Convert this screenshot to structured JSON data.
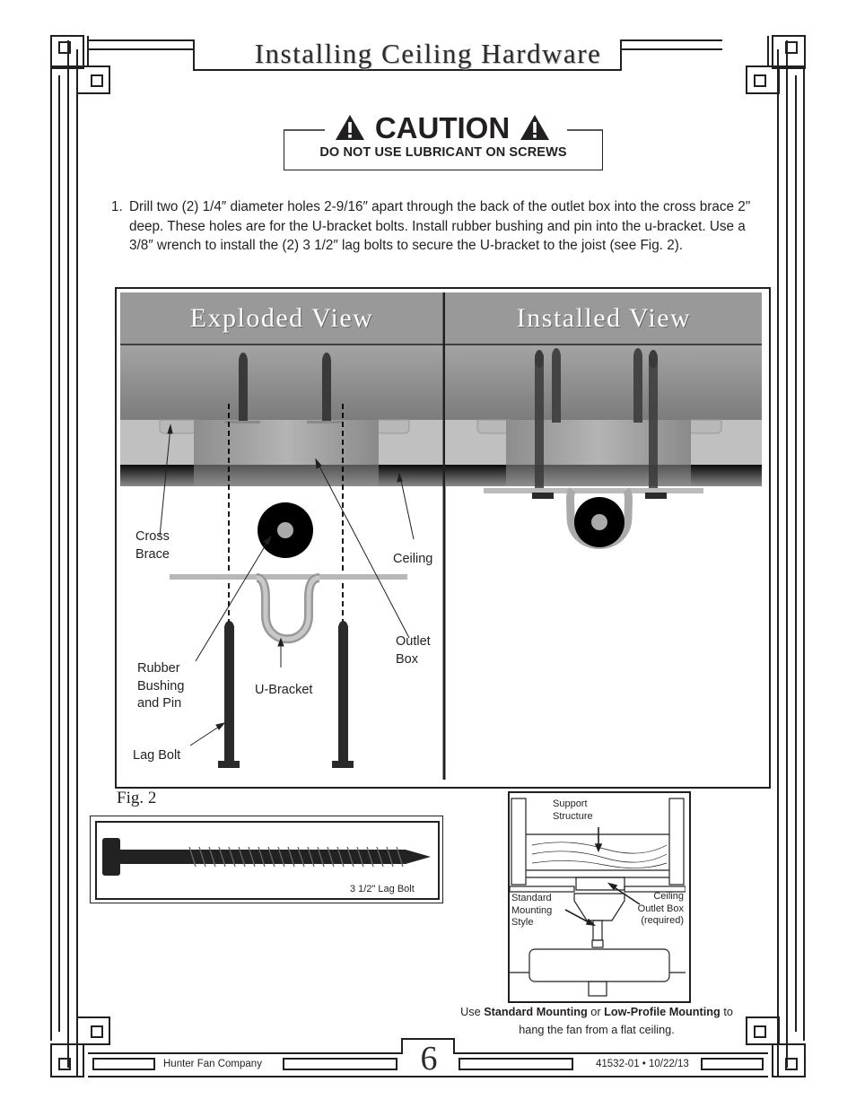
{
  "page": {
    "title": "Installing Ceiling Hardware",
    "page_number": "6",
    "footer_left": "Hunter Fan Company",
    "footer_right": "41532-01 • 10/22/13"
  },
  "caution": {
    "icon": "warning-triangle-icon",
    "title": "CAUTION",
    "message": "DO NOT USE LUBRICANT ON SCREWS"
  },
  "steps": [
    {
      "number": "1.",
      "text": "Drill two (2) 1/4″ diameter holes 2-9/16″ apart through the back of the outlet box into the cross brace 2\" deep. These holes are for the U-bracket bolts. Install rubber bushing and pin into the u-bracket. Use a 3/8″ wrench to install the (2) 3 1/2″ lag bolts to secure the U-bracket to the joist (see Fig. 2)."
    }
  ],
  "figure2": {
    "caption": "Fig. 2",
    "views": [
      {
        "title": "Exploded View"
      },
      {
        "title": "Installed View"
      }
    ],
    "labels": {
      "cross_brace": [
        "Cross",
        "Brace"
      ],
      "ceiling": "Ceiling",
      "outlet_box": [
        "Outlet",
        "Box"
      ],
      "rubber_bushing": [
        "Rubber",
        "Bushing",
        "and Pin"
      ],
      "u_bracket": "U-Bracket",
      "lag_bolt": "Lag Bolt"
    },
    "bolt_label": "3 1/2\" Lag Bolt"
  },
  "mounting_figure": {
    "labels": {
      "support_structure": [
        "Support",
        "Structure"
      ],
      "standard_mounting": [
        "Standard",
        "Mounting",
        "Style"
      ],
      "outlet_box": [
        "Ceiling",
        "Outlet Box",
        "(required)"
      ]
    },
    "caption": {
      "prefix": "Use ",
      "bold1": "Standard Mounting",
      "mid": " or ",
      "bold2": "Low-Profile Mounting",
      "suffix": " to",
      "line2": "hang the fan from a flat ceiling."
    }
  }
}
